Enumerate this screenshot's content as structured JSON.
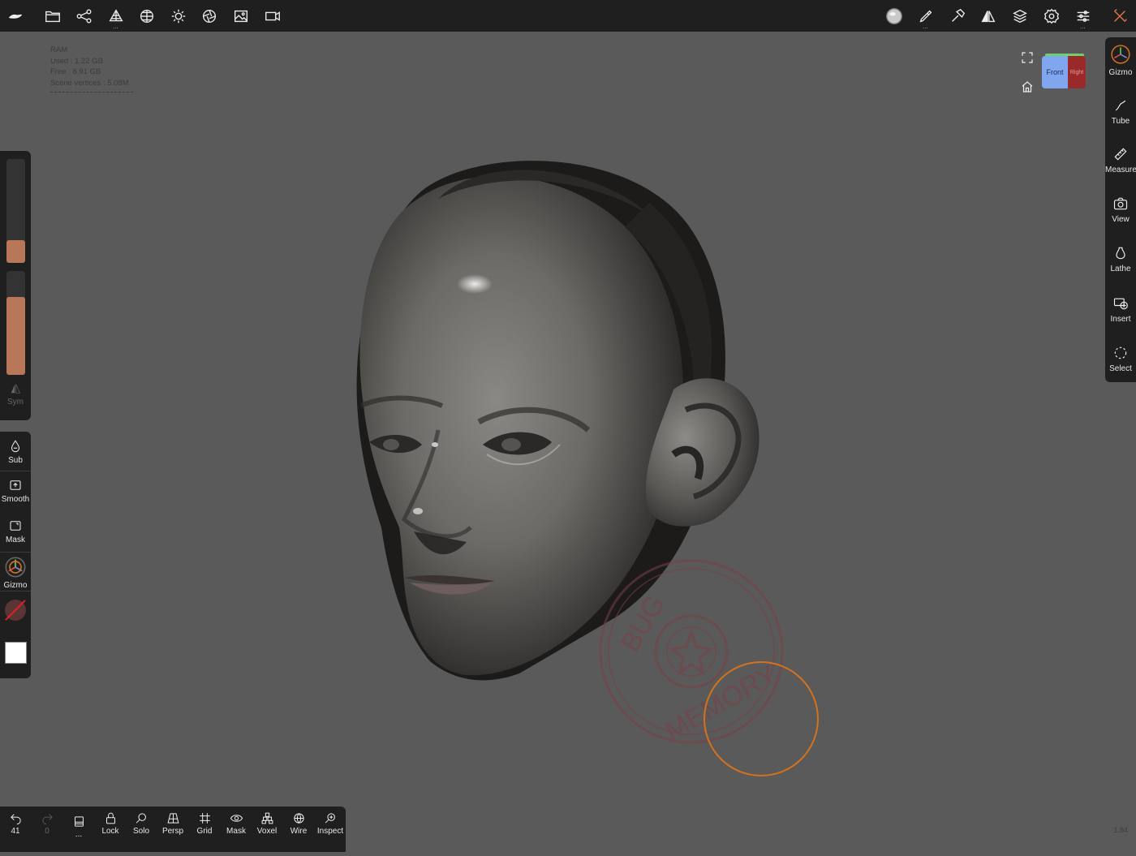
{
  "ram": {
    "title": "RAM",
    "used": "Used : 1.22 GB",
    "free": "Free : 6.91 GB",
    "vertices": "Scene vertices : 5.08M"
  },
  "top_icons": [
    "menu-logo-icon",
    "folder-icon",
    "scene-graph-icon",
    "topology-icon",
    "material-sphere-icon",
    "light-icon",
    "aperture-icon",
    "image-icon",
    "camera-video-icon",
    "matcap-sphere-icon",
    "brush-icon",
    "hammer-icon",
    "symmetry-icon",
    "layers-icon",
    "settings-icon",
    "sliders-icon",
    "tools-cross-icon"
  ],
  "viewcube": {
    "front": "Front",
    "right": "Right"
  },
  "left": {
    "radius_fill": 0.22,
    "intensity_fill": 0.75,
    "sym": "Sym",
    "tools": {
      "sub": "Sub",
      "smooth": "Smooth",
      "mask": "Mask",
      "gizmo": "Gizmo"
    }
  },
  "right": {
    "tools": [
      "Gizmo",
      "Tube",
      "Measure",
      "View",
      "Lathe",
      "Insert",
      "Select"
    ]
  },
  "bottom": {
    "undo_count": "41",
    "redo_count": "0",
    "more": "...",
    "lock": "Lock",
    "solo": "Solo",
    "persp": "Persp",
    "grid": "Grid",
    "mask": "Mask",
    "voxel": "Voxel",
    "wire": "Wire",
    "inspect": "Inspect"
  },
  "version": "1.84",
  "colors": {
    "accent": "#b9775a",
    "brush_circle": "#d4711f",
    "panel": "#1f1f1f",
    "background": "#5a5a5a"
  }
}
